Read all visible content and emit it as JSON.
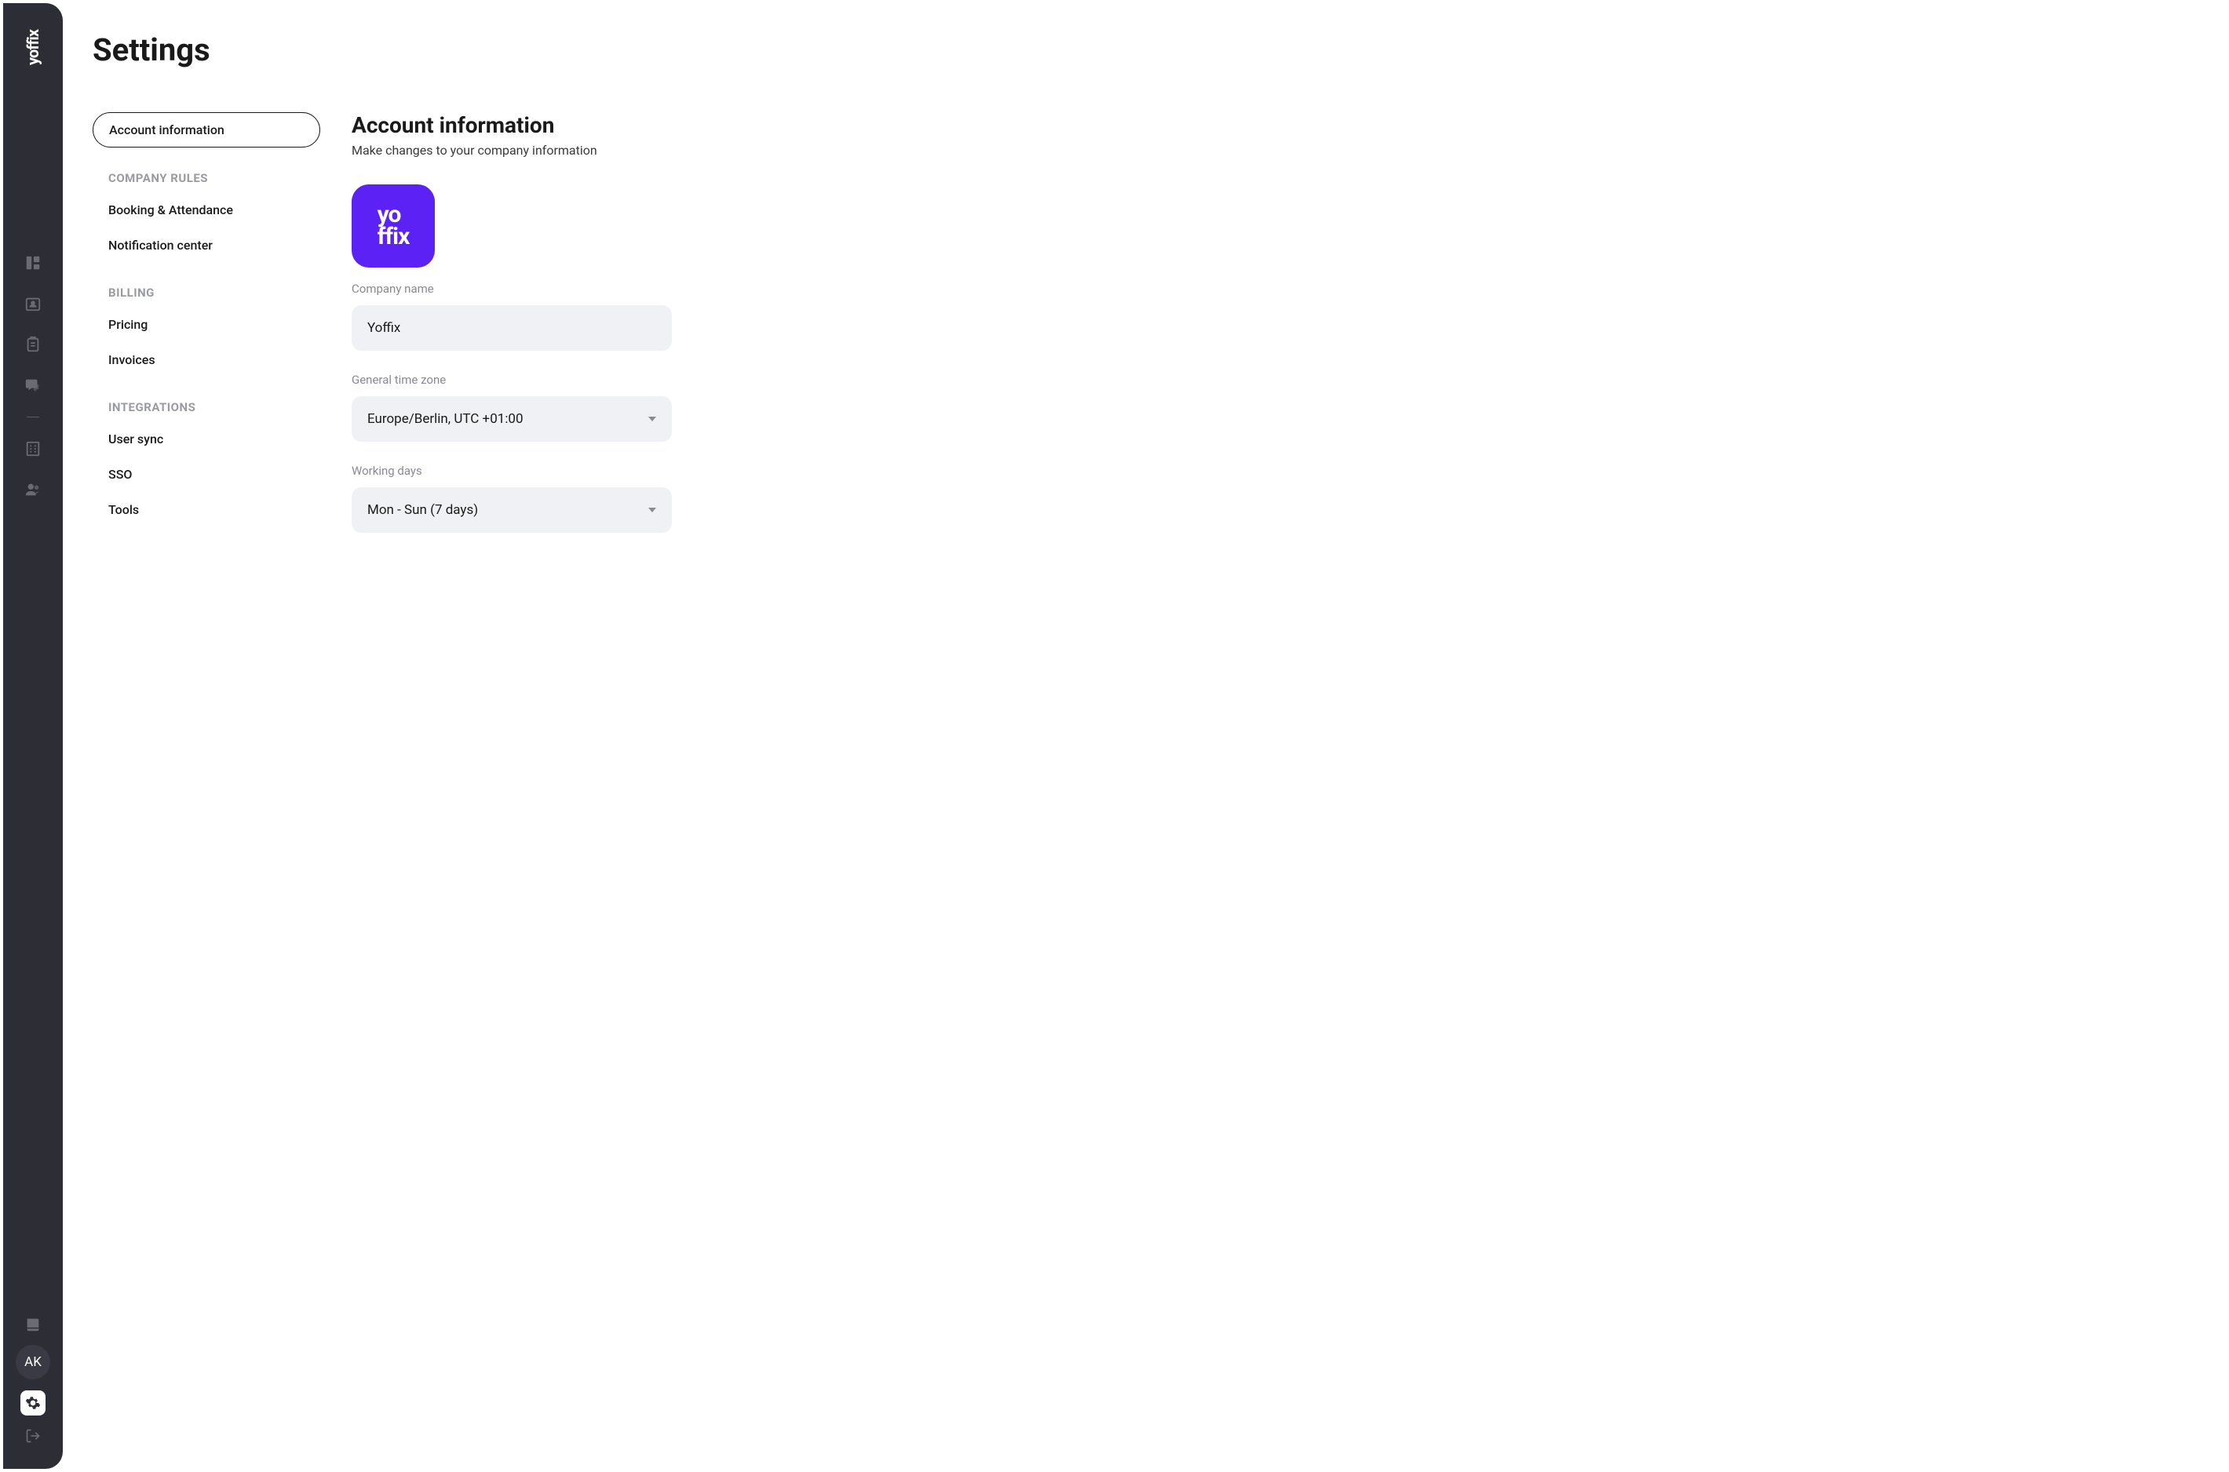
{
  "app": {
    "logo": "yoffix",
    "avatar_initials": "AK"
  },
  "page": {
    "title": "Settings"
  },
  "settings_nav": {
    "account_information": "Account information",
    "sections": {
      "company_rules": {
        "title": "COMPANY RULES",
        "items": {
          "booking_attendance": "Booking & Attendance",
          "notification_center": "Notification center"
        }
      },
      "billing": {
        "title": "BILLING",
        "items": {
          "pricing": "Pricing",
          "invoices": "Invoices"
        }
      },
      "integrations": {
        "title": "INTEGRATIONS",
        "items": {
          "user_sync": "User sync",
          "sso": "SSO",
          "tools": "Tools"
        }
      }
    }
  },
  "account_info": {
    "title": "Account information",
    "subtitle": "Make changes to your company information",
    "company_logo_text_line1": "yo",
    "company_logo_text_line2": "ffix",
    "fields": {
      "company_name": {
        "label": "Company name",
        "value": "Yoffix"
      },
      "timezone": {
        "label": "General time zone",
        "value": "Europe/Berlin, UTC +01:00"
      },
      "working_days": {
        "label": "Working days",
        "value": "Mon - Sun (7 days)"
      }
    }
  }
}
